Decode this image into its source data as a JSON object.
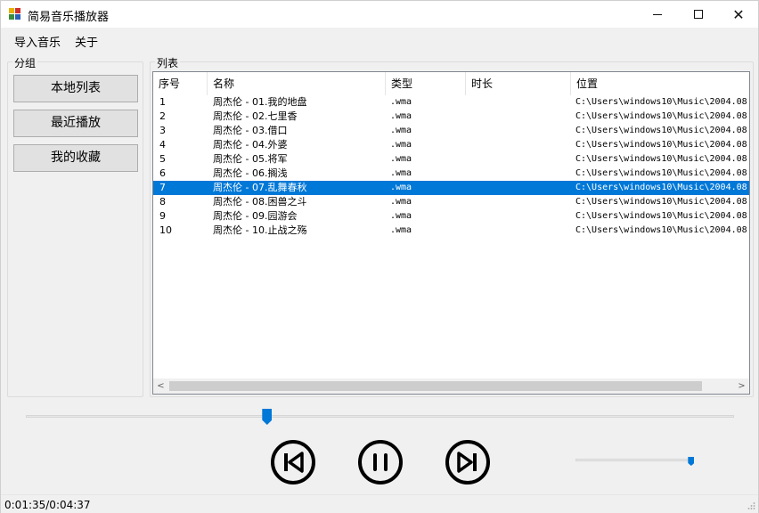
{
  "window": {
    "title": "简易音乐播放器",
    "icon": "app-window-icon",
    "controls": {
      "minimize": "minimize-icon",
      "maximize": "maximize-icon",
      "close": "close-icon"
    },
    "close_glyph": "✕"
  },
  "menu": {
    "import": "导入音乐",
    "about": "关于"
  },
  "sidebar": {
    "legend": "分组",
    "buttons": [
      "本地列表",
      "最近播放",
      "我的收藏"
    ]
  },
  "playlist": {
    "legend": "列表",
    "columns": [
      "序号",
      "名称",
      "类型",
      "时长",
      "位置"
    ],
    "selected_index": 6,
    "rows": [
      {
        "idx": "1",
        "name": "周杰伦 - 01.我的地盘",
        "type": ".wma",
        "duration": "",
        "path": "C:\\Users\\windows10\\Music\\2004.08."
      },
      {
        "idx": "2",
        "name": "周杰伦 - 02.七里香",
        "type": ".wma",
        "duration": "",
        "path": "C:\\Users\\windows10\\Music\\2004.08."
      },
      {
        "idx": "3",
        "name": "周杰伦 - 03.借口",
        "type": ".wma",
        "duration": "",
        "path": "C:\\Users\\windows10\\Music\\2004.08."
      },
      {
        "idx": "4",
        "name": "周杰伦 - 04.外婆",
        "type": ".wma",
        "duration": "",
        "path": "C:\\Users\\windows10\\Music\\2004.08."
      },
      {
        "idx": "5",
        "name": "周杰伦 - 05.将军",
        "type": ".wma",
        "duration": "",
        "path": "C:\\Users\\windows10\\Music\\2004.08."
      },
      {
        "idx": "6",
        "name": "周杰伦 - 06.搁浅",
        "type": ".wma",
        "duration": "",
        "path": "C:\\Users\\windows10\\Music\\2004.08."
      },
      {
        "idx": "7",
        "name": "周杰伦 - 07.乱舞春秋",
        "type": ".wma",
        "duration": "",
        "path": "C:\\Users\\windows10\\Music\\2004.08."
      },
      {
        "idx": "8",
        "name": "周杰伦 - 08.困兽之斗",
        "type": ".wma",
        "duration": "",
        "path": "C:\\Users\\windows10\\Music\\2004.08."
      },
      {
        "idx": "9",
        "name": "周杰伦 - 09.园游会",
        "type": ".wma",
        "duration": "",
        "path": "C:\\Users\\windows10\\Music\\2004.08."
      },
      {
        "idx": "10",
        "name": "周杰伦 - 10.止战之殇",
        "type": ".wma",
        "duration": "",
        "path": "C:\\Users\\windows10\\Music\\2004.08."
      }
    ]
  },
  "player": {
    "progress_fraction": 0.34,
    "volume_fraction": 0.98,
    "buttons": [
      "previous-icon",
      "pause-icon",
      "next-icon"
    ]
  },
  "status": {
    "time": "0:01:35/0:04:37"
  },
  "colors": {
    "accent": "#0078d7",
    "button_face": "#e1e1e1",
    "window_bg": "#f0f0f0"
  }
}
